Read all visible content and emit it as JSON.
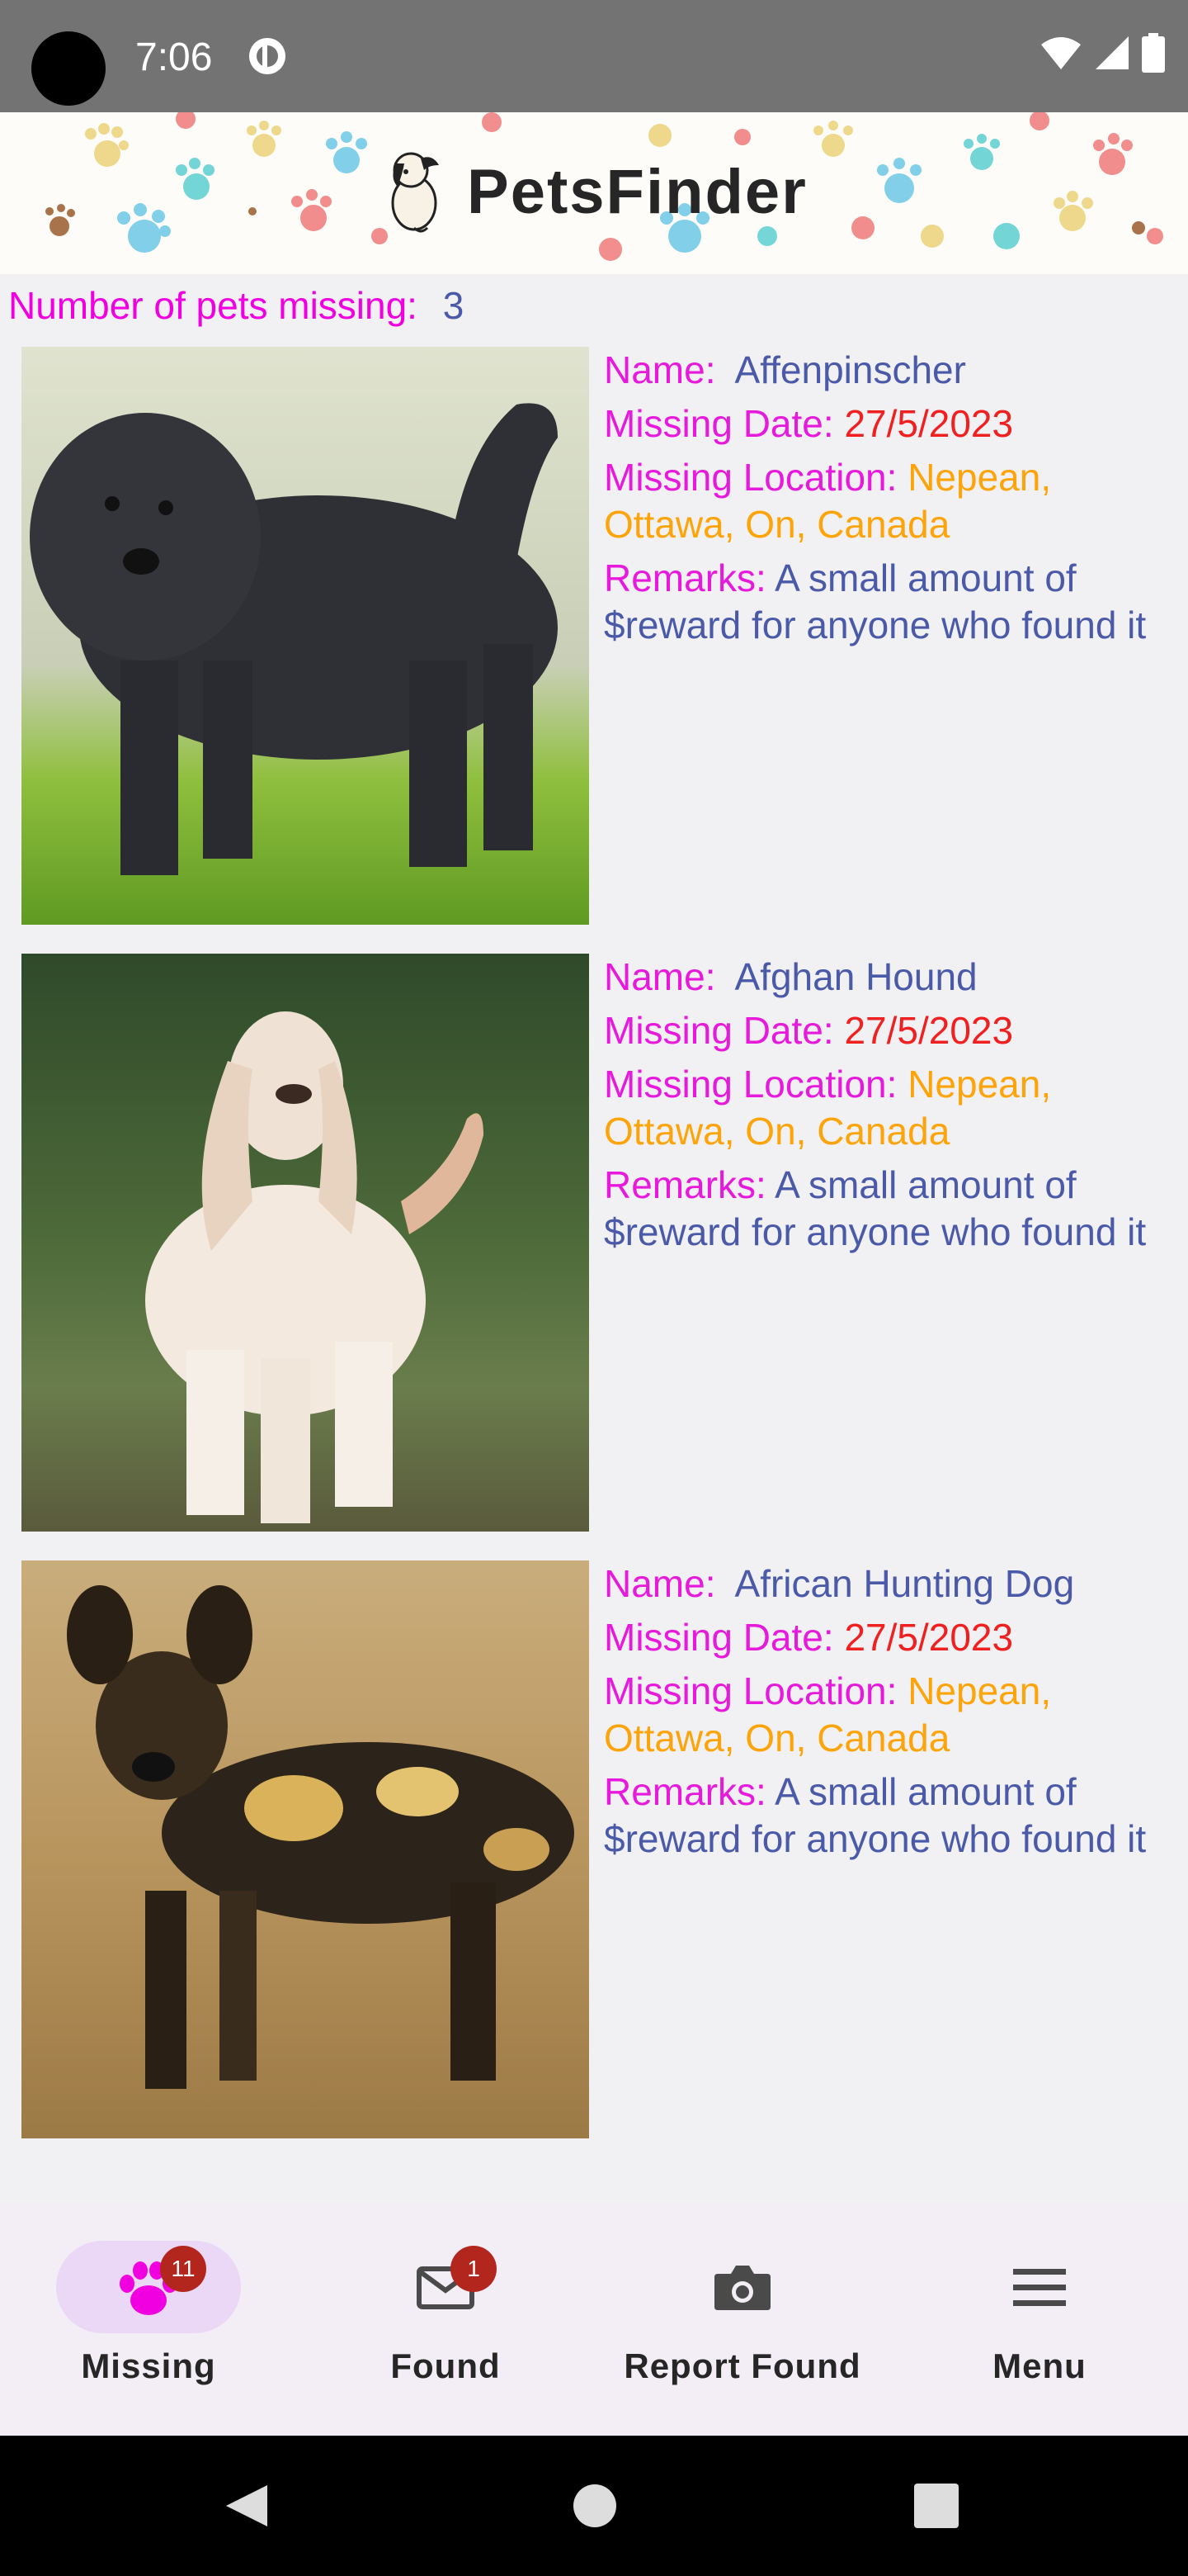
{
  "status_bar": {
    "time": "7:06"
  },
  "header": {
    "app_name": "PetsFinder"
  },
  "summary": {
    "label": "Number of pets missing:",
    "count": "3"
  },
  "labels": {
    "name": "Name:",
    "missing_date": "Missing Date:",
    "missing_location": "Missing Location:",
    "remarks": "Remarks:"
  },
  "pets": [
    {
      "name": "Affenpinscher",
      "missing_date": "27/5/2023",
      "location": "Nepean, Ottawa, On, Canada",
      "remarks": "A small amount of $reward for anyone who found it"
    },
    {
      "name": "Afghan Hound",
      "missing_date": "27/5/2023",
      "location": "Nepean, Ottawa, On, Canada",
      "remarks": "A small amount of $reward for anyone who found it"
    },
    {
      "name": "African Hunting Dog",
      "missing_date": "27/5/2023",
      "location": "Nepean, Ottawa, On, Canada",
      "remarks": "A small amount of $reward for anyone who found it"
    }
  ],
  "bottom_nav": {
    "items": [
      {
        "label": "Missing",
        "icon": "paw-icon",
        "badge": "11",
        "active": true
      },
      {
        "label": "Found",
        "icon": "mail-icon",
        "badge": "1",
        "active": false
      },
      {
        "label": "Report Found",
        "icon": "camera-icon",
        "active": false
      },
      {
        "label": "Menu",
        "icon": "menu-icon",
        "active": false
      }
    ]
  },
  "colors": {
    "label_magenta": "#e619dc",
    "value_blue": "#4a5aa8",
    "date_red": "#f02020",
    "location_orange": "#fca40a",
    "badge_red": "#b3261e",
    "active_pill": "#ead8f6",
    "nav_background": "#f3edf6"
  }
}
